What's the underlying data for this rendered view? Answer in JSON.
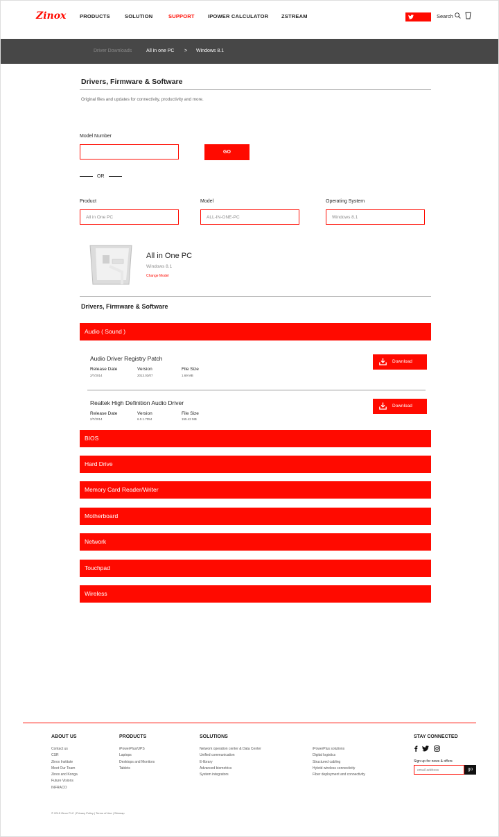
{
  "header": {
    "logo": "Zinox",
    "nav": [
      "PRODUCTS",
      "SOLUTION",
      "SUPPORT",
      "IPOWER CALCULATOR",
      "ZSTREAM"
    ],
    "active_nav": "SUPPORT",
    "search_label": "Search"
  },
  "breadcrumb": {
    "items": [
      "Driver Downloads",
      "All in one PC",
      ">",
      "Windows 8.1"
    ]
  },
  "page": {
    "title": "Drivers, Firmware & Software",
    "subtitle": "Original files and updates for connectivity, productivity and more."
  },
  "search": {
    "model_number_label": "Model Number",
    "model_number_value": "",
    "go_label": "GO",
    "or_label": "OR",
    "product_label": "Product",
    "product_value": "All in One PC",
    "model_label": "Model",
    "model_value": "ALL-IN-ONE-PC",
    "os_label": "Operating System",
    "os_value": "Windows 8.1"
  },
  "selected_product": {
    "name": "All in One PC",
    "os": "Windows 8.1",
    "change_label": "Change Model"
  },
  "downloads": {
    "section_title": "Drivers, Firmware & Software",
    "categories": [
      "Audio ( Sound )",
      "BIOS",
      "Hard Drive",
      "Memory Card Reader/Writer",
      "Motherboard",
      "Network",
      "Touchpad",
      "Wireless"
    ],
    "headers": {
      "release_date": "Release Date",
      "version": "Version",
      "file_size": "File Size"
    },
    "download_label": "Download",
    "drivers": [
      {
        "name": "Audio Driver Registry Patch",
        "release_date": "2/7/2014",
        "version": "2013.03/07",
        "file_size": "1.69 MB"
      },
      {
        "name": "Realtek High Definition Audio Driver",
        "release_date": "2/7/2014",
        "version": "6.0.1.7054",
        "file_size": "155.42 MB"
      }
    ]
  },
  "footer": {
    "about_title": "ABOUT US",
    "about_links": [
      "Contact us",
      "CSR",
      "Zinox Institute",
      "Meet Our Team",
      "Zinox and Konga",
      "Future Visions",
      "INFRACO"
    ],
    "products_title": "PRODUCTS",
    "products_links": [
      "iPowerPlus/UPS",
      "Laptops",
      "Desktops and Monitors",
      "Tablets"
    ],
    "solutions_title": "SOLUTIONS",
    "solutions_links_1": [
      "Network operation center & Data Center",
      "Unified communication",
      "E-library",
      "Advanced biometrics",
      "System integrators"
    ],
    "solutions_links_2": [
      "iPowerPlus solutions",
      "Digital logistics",
      "Structured cabling",
      "Hybrid wireless connectivity",
      "Fiber deployment and connectivity"
    ],
    "stay_title": "STAY CONNECTED",
    "signup_label": "Sign up for news & offers",
    "email_placeholder": "email address",
    "email_go": "go",
    "copyright": "© 2015 Zinox PLC | Privacy Policy | Terms of Use | Sitemap"
  }
}
